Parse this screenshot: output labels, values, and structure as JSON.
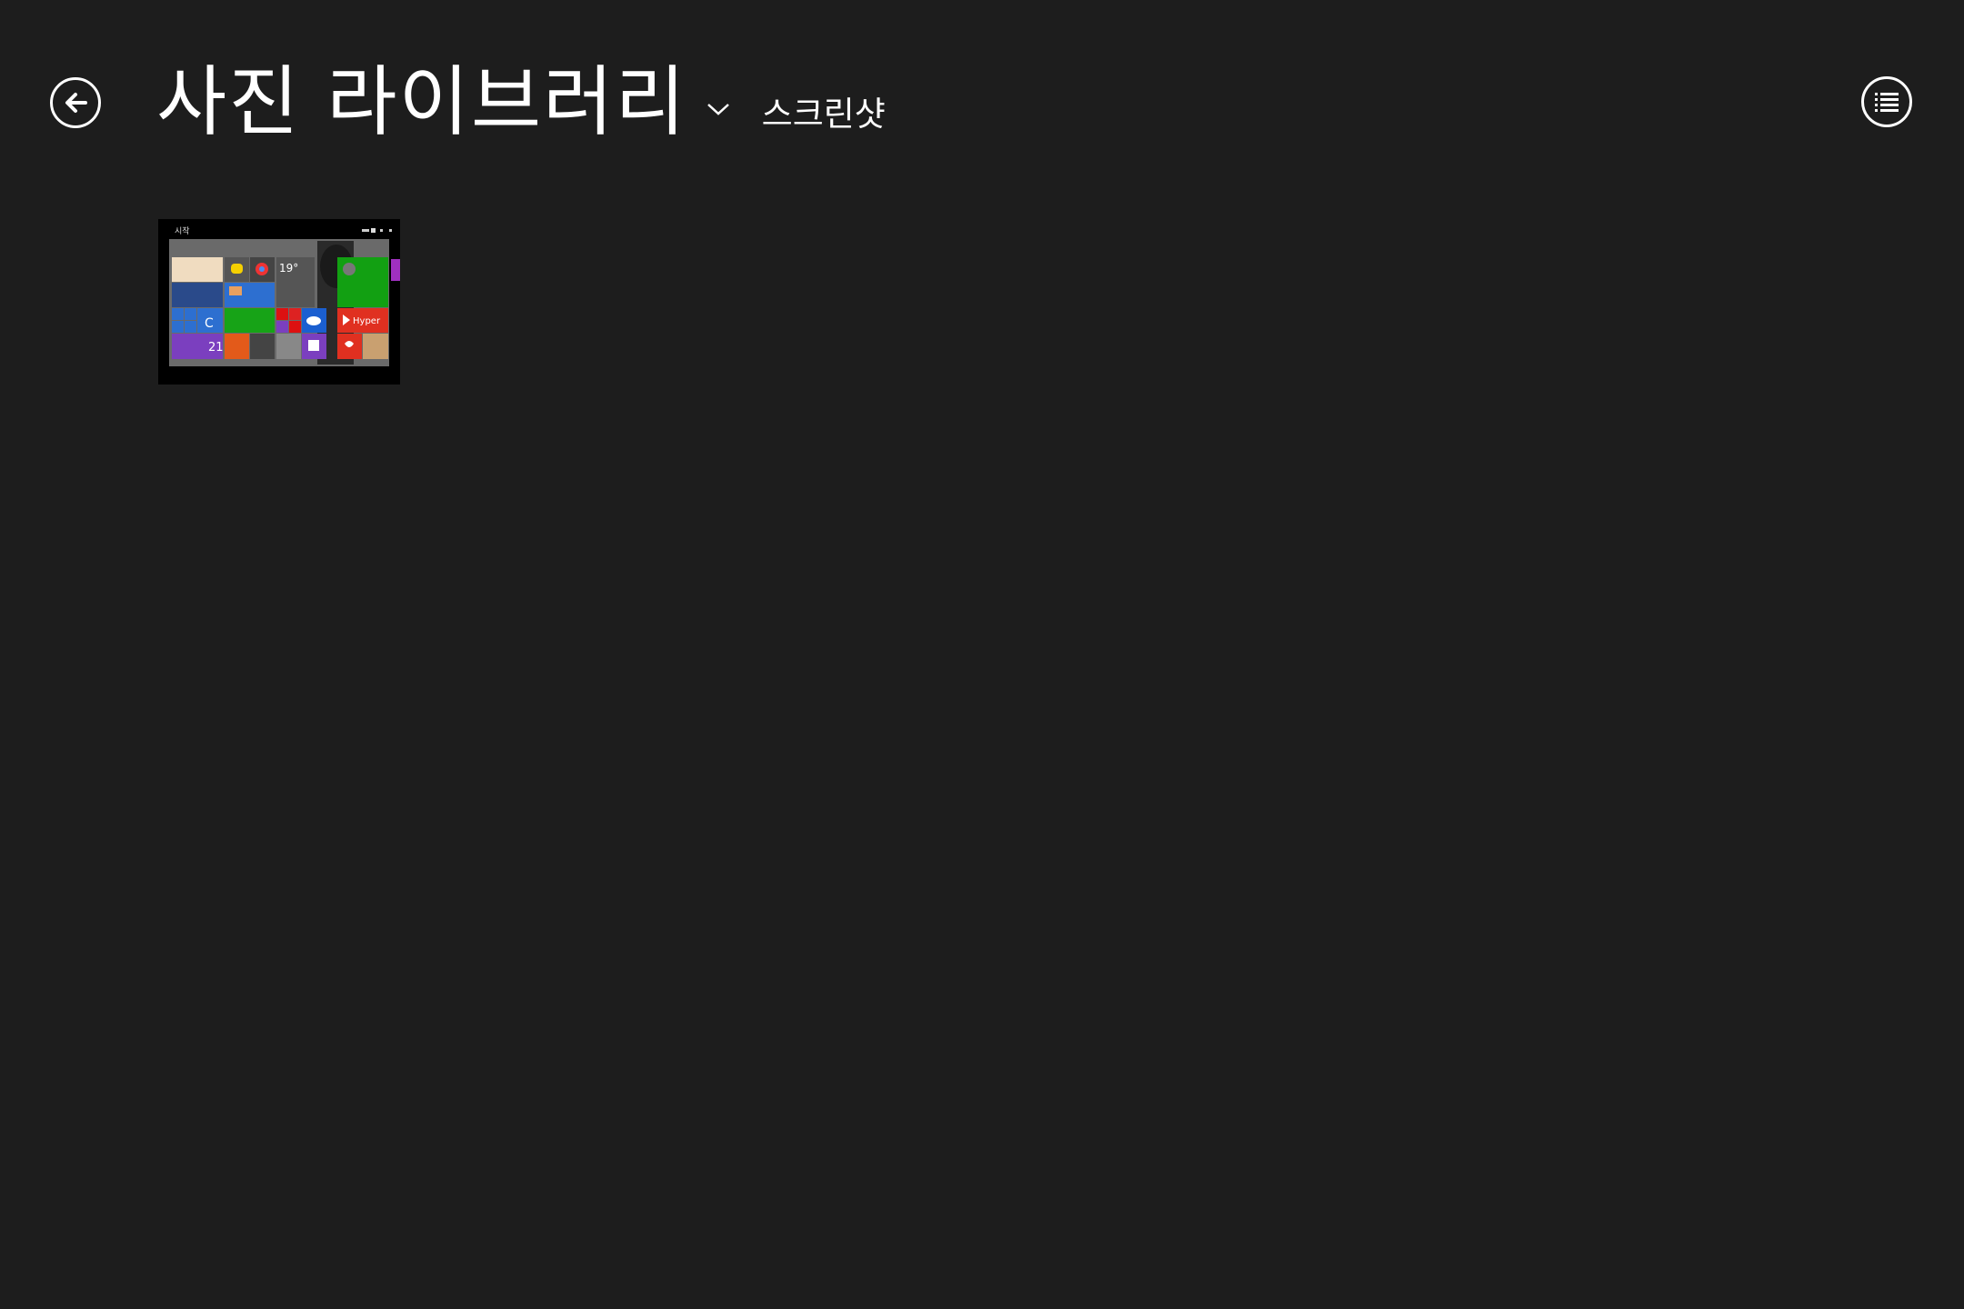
{
  "header": {
    "title": "사진 라이브러리",
    "subtitle": "스크린샷"
  },
  "icons": {
    "back": "back-arrow-icon",
    "dropdown": "chevron-down-icon",
    "view": "list-view-icon"
  },
  "thumbnail": {
    "start_label": "시작",
    "weather_temp": "19°",
    "calendar_day": "21",
    "hyper_label": "Hyper"
  },
  "colors": {
    "background": "#1d1d1d",
    "text": "#ffffff"
  }
}
